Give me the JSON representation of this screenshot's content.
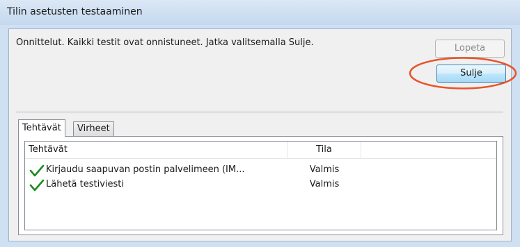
{
  "window": {
    "title": "Tilin asetusten testaaminen"
  },
  "message": "Onnittelut. Kaikki testit ovat onnistuneet. Jatka valitsemalla Sulje.",
  "buttons": {
    "stop_label": "Lopeta",
    "close_label": "Sulje"
  },
  "tabs": [
    {
      "label": "Tehtävät",
      "active": true
    },
    {
      "label": "Virheet",
      "active": false
    }
  ],
  "list": {
    "columns": [
      "Tehtävät",
      "Tila"
    ],
    "rows": [
      {
        "task": "Kirjaudu saapuvan postin palvelimeen (IM...",
        "state": "Valmis",
        "icon": "check-icon"
      },
      {
        "task": "Lähetä testiviesti",
        "state": "Valmis",
        "icon": "check-icon"
      }
    ]
  },
  "colors": {
    "highlight": "#e8532a",
    "check": "#1f8a1f"
  }
}
